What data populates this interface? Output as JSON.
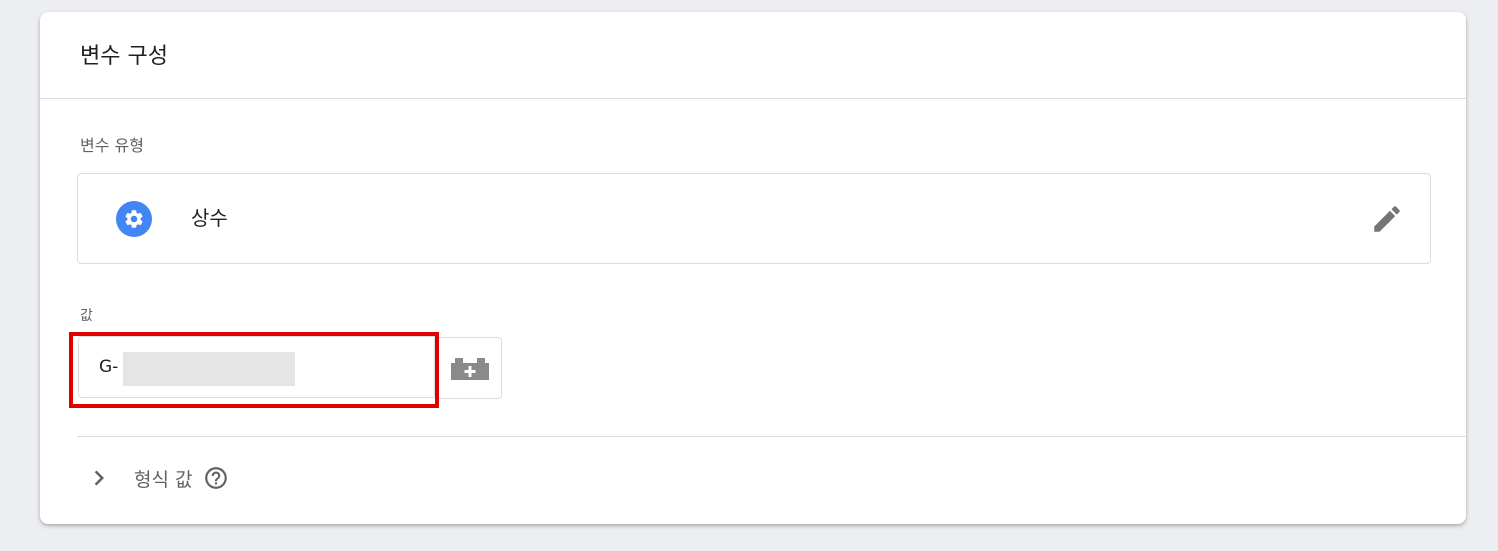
{
  "card": {
    "title": "변수 구성"
  },
  "variable_type": {
    "label": "변수 유형",
    "selected_type": "상수",
    "type_icon": "gear-icon",
    "edit_icon": "pencil-icon"
  },
  "value_field": {
    "label": "값",
    "value": "G-"
  },
  "variable_picker": {
    "icon": "lego-brick-plus-icon"
  },
  "format_section": {
    "label": "형식 값",
    "expand_icon": "chevron-right-icon",
    "help_icon": "question-circle-icon"
  },
  "colors": {
    "accent": "#4285f4",
    "highlight": "#e00000",
    "border": "#dadce0",
    "muted_text": "#5f6368"
  }
}
